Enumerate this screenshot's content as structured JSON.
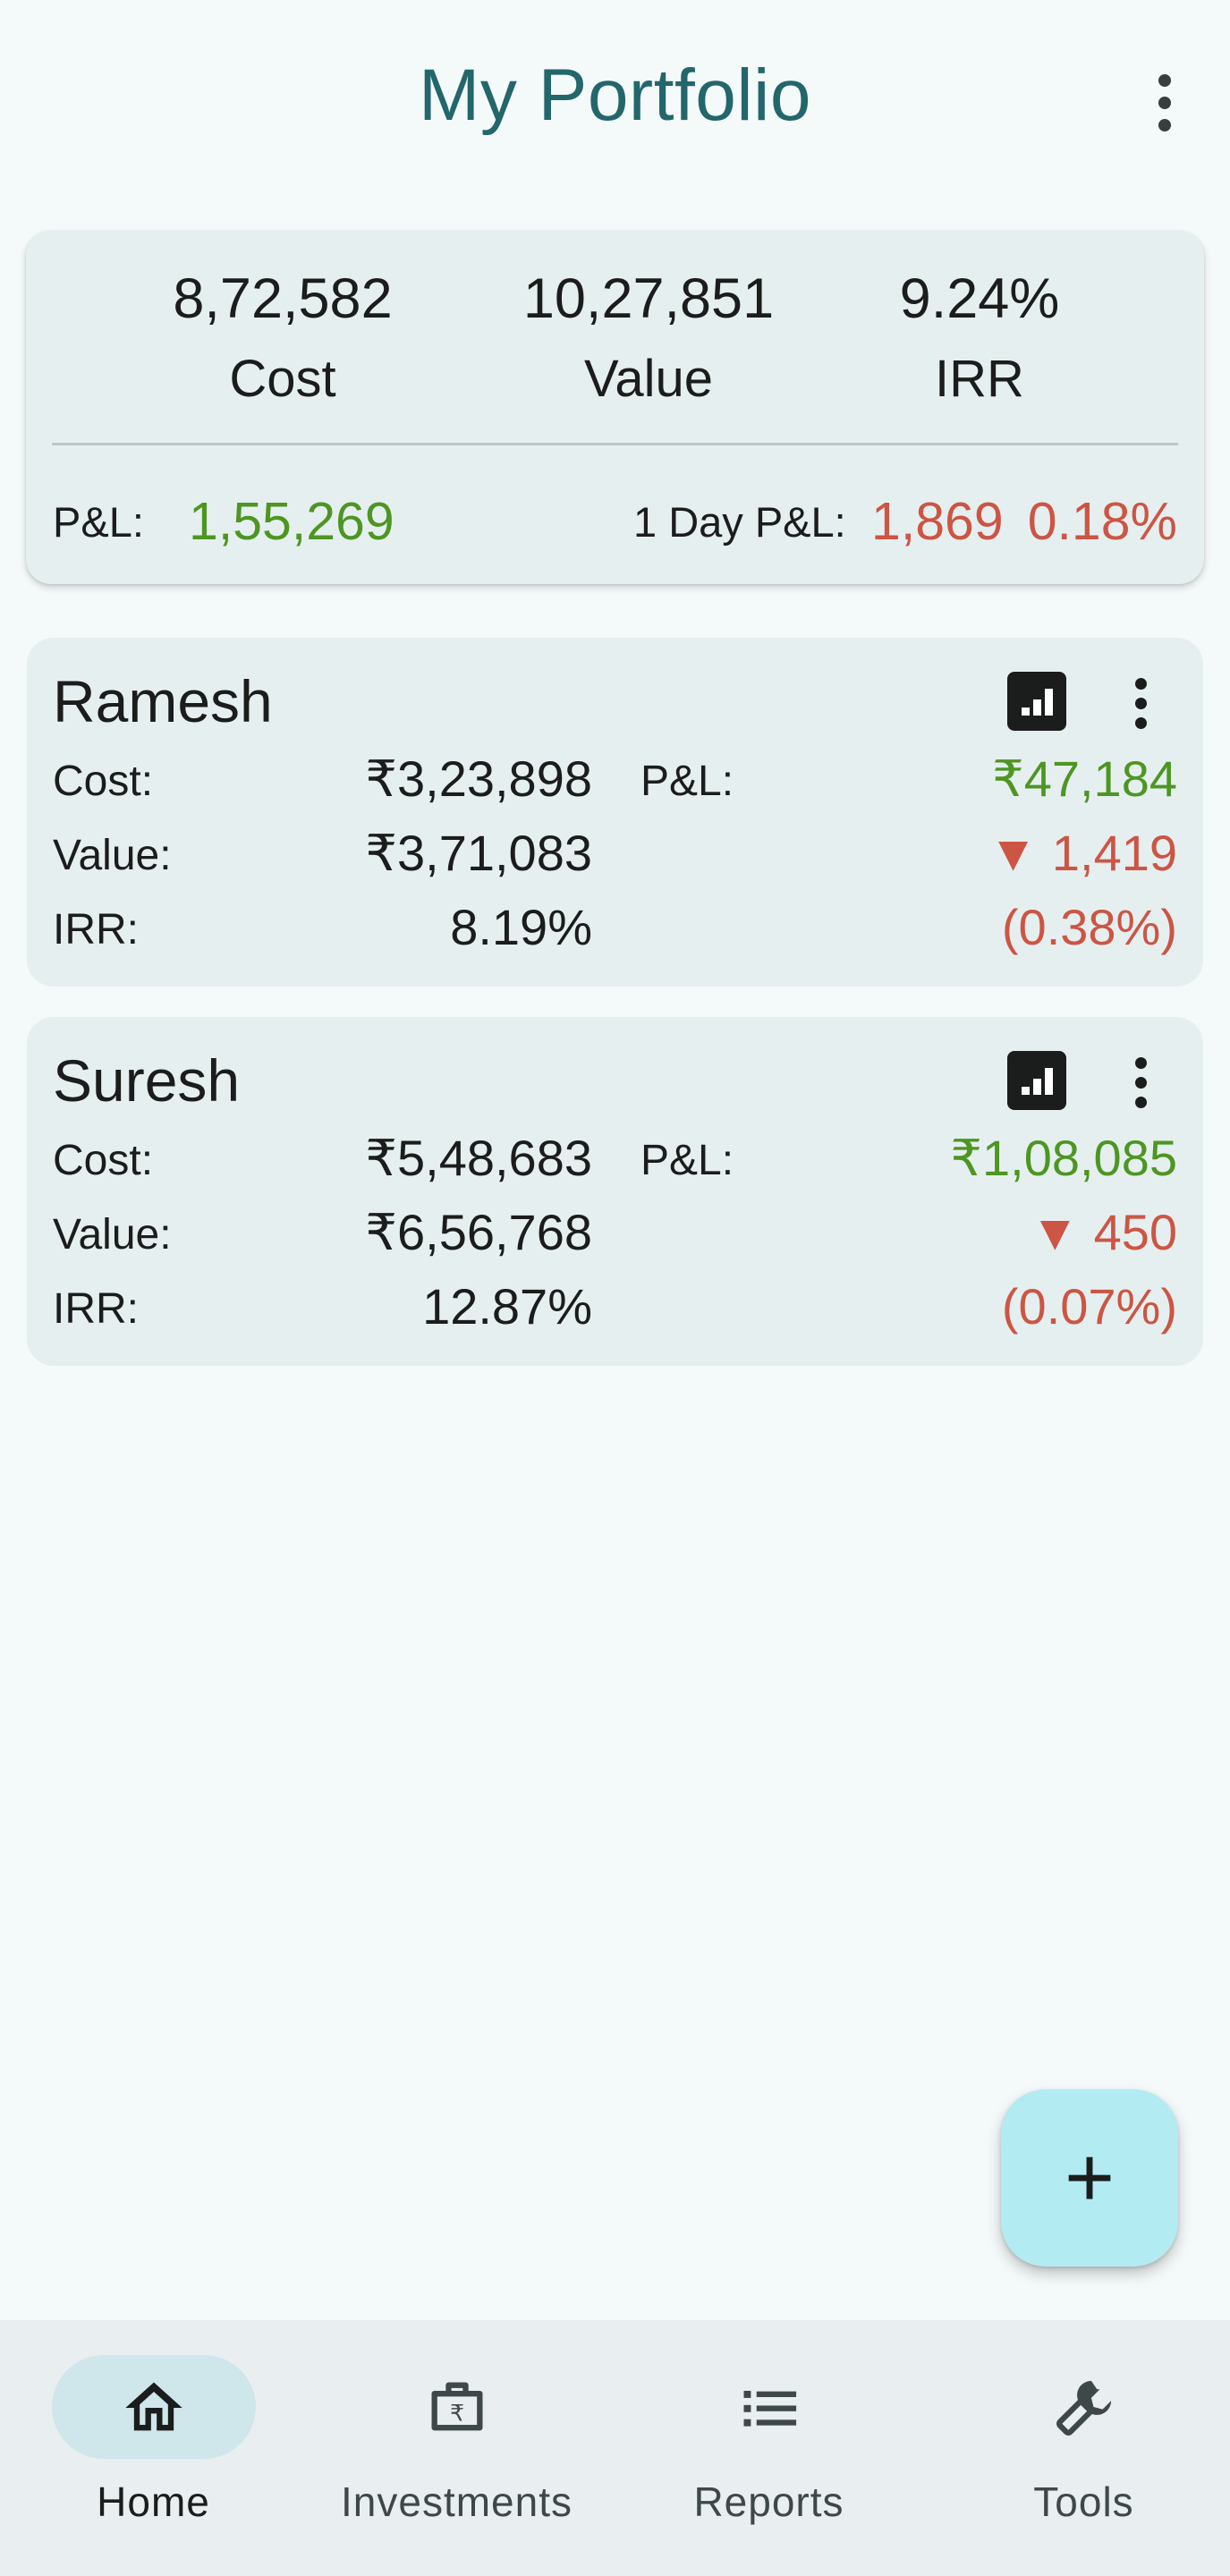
{
  "app": {
    "title": "My Portfolio"
  },
  "summary": {
    "cost_value": "8,72,582",
    "cost_label": "Cost",
    "value_value": "10,27,851",
    "value_label": "Value",
    "irr_value": "9.24%",
    "irr_label": "IRR",
    "pl_label": "P&L:",
    "pl_value": "1,55,269",
    "day_pl_label": "1 Day P&L:",
    "day_pl_value": "1,869",
    "day_pl_pct": "0.18%"
  },
  "members": [
    {
      "name": "Ramesh",
      "cost_label": "Cost:",
      "cost": "₹3,23,898",
      "value_label": "Value:",
      "value": "₹3,71,083",
      "irr_label": "IRR:",
      "irr": "8.19%",
      "pl_label": "P&L:",
      "pl": "₹47,184",
      "day_change": "▼ 1,419",
      "day_change_pct": "(0.38%)"
    },
    {
      "name": "Suresh",
      "cost_label": "Cost:",
      "cost": "₹5,48,683",
      "value_label": "Value:",
      "value": "₹6,56,768",
      "irr_label": "IRR:",
      "irr": "12.87%",
      "pl_label": "P&L:",
      "pl": "₹1,08,085",
      "day_change": "▼ 450",
      "day_change_pct": "(0.07%)"
    }
  ],
  "fab": {
    "icon": "plus-icon",
    "glyph": "+"
  },
  "nav": {
    "items": [
      {
        "label": "Home",
        "icon": "home-icon",
        "active": true
      },
      {
        "label": "Investments",
        "icon": "briefcase-rupee-icon",
        "active": false
      },
      {
        "label": "Reports",
        "icon": "list-icon",
        "active": false
      },
      {
        "label": "Tools",
        "icon": "wrench-icon",
        "active": false
      }
    ]
  },
  "colors": {
    "title": "#23666b",
    "positive": "#4d9622",
    "negative": "#cc5544",
    "card": "#e6eff0",
    "background": "#f4f9fa",
    "fab": "#b2ebf2",
    "nav_active_pill": "#cfe6ea"
  }
}
